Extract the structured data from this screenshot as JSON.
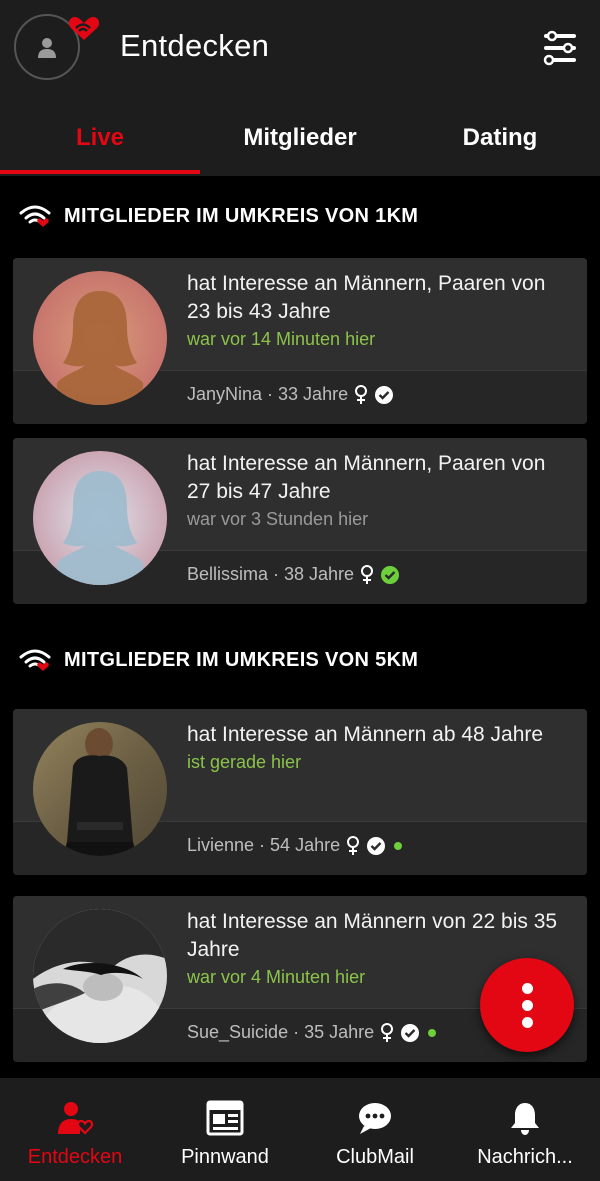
{
  "header": {
    "title": "Entdecken"
  },
  "tabs": [
    {
      "label": "Live",
      "active": true
    },
    {
      "label": "Mitglieder",
      "active": false
    },
    {
      "label": "Dating",
      "active": false
    }
  ],
  "sections": [
    {
      "heading": "MITGLIEDER IM UMKREIS VON 1KM",
      "members": [
        {
          "interest": "hat Interesse an Männern, Paaren von 23 bis 43 Jahre",
          "seen": "war vor 14 Minuten hier",
          "seen_color": "#8bc34a",
          "meta": "JanyNina · 33 Jahre",
          "online": false,
          "photo": "placeholder-female-brown"
        },
        {
          "interest": "hat Interesse an Männern, Paaren von 27 bis 47 Jahre",
          "seen": "war vor 3 Stunden hier",
          "seen_color": "#9a9a9a",
          "meta": "Bellissima · 38 Jahre",
          "online": false,
          "photo": "placeholder-female-blue"
        }
      ]
    },
    {
      "heading": "MITGLIEDER IM UMKREIS VON 5KM",
      "members": [
        {
          "interest": "hat Interesse an Männern ab 48 Jahre",
          "seen": "ist gerade hier",
          "seen_color": "#8bc34a",
          "meta": "Livienne · 54 Jahre",
          "online": true,
          "photo": "photo-woman-dark-dress"
        },
        {
          "interest": "hat Interesse an Männern von 22 bis 35 Jahre",
          "seen": "war vor 4 Minuten hier",
          "seen_color": "#8bc34a",
          "meta": "Sue_Suicide · 35 Jahre",
          "online": true,
          "photo": "photo-woman-bw"
        }
      ]
    }
  ],
  "nav": [
    {
      "label": "Entdecken",
      "icon": "discover-icon",
      "active": true
    },
    {
      "label": "Pinnwand",
      "icon": "pinboard-icon",
      "active": false
    },
    {
      "label": "ClubMail",
      "icon": "chat-icon",
      "active": false
    },
    {
      "label": "Nachrich...",
      "icon": "bell-icon",
      "active": false
    }
  ],
  "colors": {
    "accent": "#e30613",
    "online": "#6ccf3b",
    "seen_recent": "#8bc34a",
    "background": "#000000",
    "bar": "#1d1d1d"
  }
}
